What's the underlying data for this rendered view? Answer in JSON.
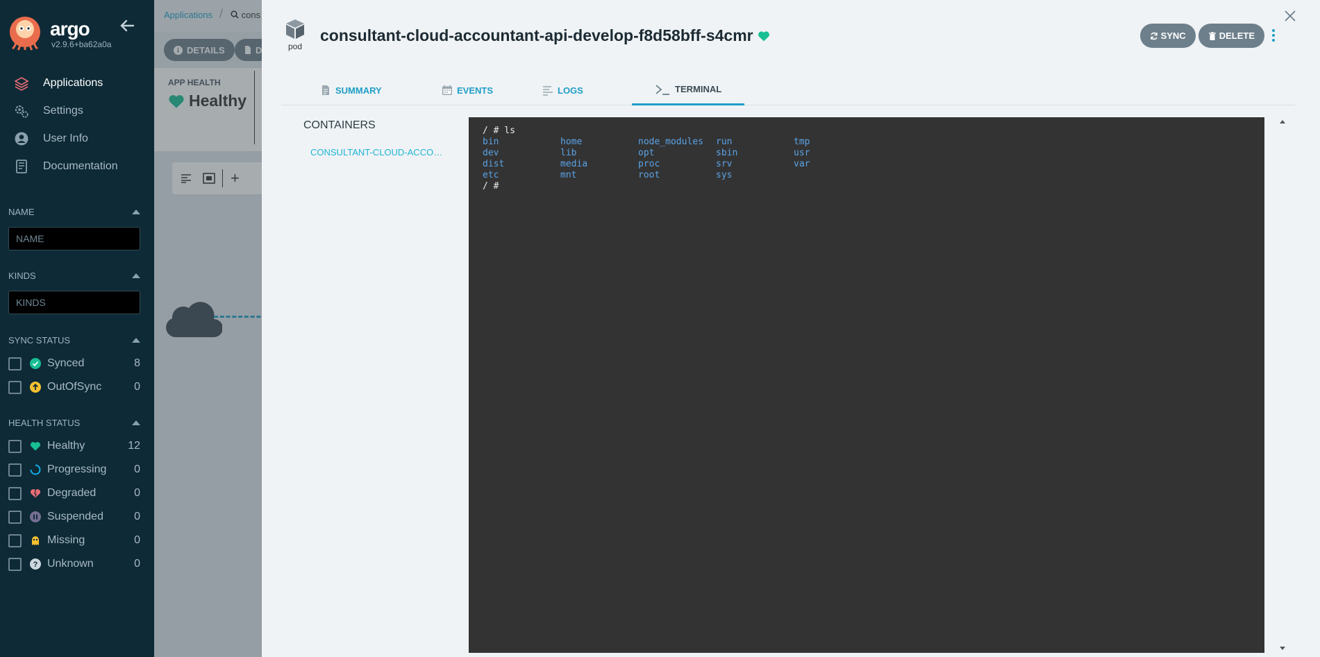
{
  "sidebar": {
    "logo_text": "argo",
    "version": "v2.9.6+ba62a0a",
    "nav": [
      {
        "label": "Applications",
        "icon": "layers-icon",
        "active": true
      },
      {
        "label": "Settings",
        "icon": "gears-icon",
        "active": false
      },
      {
        "label": "User Info",
        "icon": "user-circle-icon",
        "active": false
      },
      {
        "label": "Documentation",
        "icon": "book-icon",
        "active": false
      }
    ],
    "name_filter": {
      "title": "NAME",
      "placeholder": "NAME"
    },
    "kinds_filter": {
      "title": "KINDS",
      "placeholder": "KINDS"
    },
    "sync_status": {
      "title": "SYNC STATUS",
      "items": [
        {
          "label": "Synced",
          "count": "8",
          "color": "#18be94"
        },
        {
          "label": "OutOfSync",
          "count": "0",
          "color": "#f4c030"
        }
      ]
    },
    "health_status": {
      "title": "HEALTH STATUS",
      "items": [
        {
          "label": "Healthy",
          "count": "12",
          "color": "#18be94"
        },
        {
          "label": "Progressing",
          "count": "0",
          "color": "#0dadea"
        },
        {
          "label": "Degraded",
          "count": "0",
          "color": "#e96d76"
        },
        {
          "label": "Suspended",
          "count": "0",
          "color": "#766f94"
        },
        {
          "label": "Missing",
          "count": "0",
          "color": "#f4c030"
        },
        {
          "label": "Unknown",
          "count": "0",
          "color": "#ccd6dd"
        }
      ]
    }
  },
  "background": {
    "breadcrumb": "Applications",
    "search_partial": "cons",
    "details_btn": "DETAILS",
    "diff_btn_partial": "D",
    "app_health_label": "APP HEALTH",
    "app_health_value": "Healthy"
  },
  "panel": {
    "kind_label": "pod",
    "title": "consultant-cloud-accountant-api-develop-f8d58bff-s4cmr",
    "sync_label": "SYNC",
    "delete_label": "DELETE",
    "tabs": [
      {
        "label": "SUMMARY",
        "icon": "file-icon"
      },
      {
        "label": "EVENTS",
        "icon": "calendar-icon"
      },
      {
        "label": "LOGS",
        "icon": "lines-icon"
      },
      {
        "label": "TERMINAL",
        "icon": "terminal-icon"
      }
    ],
    "containers_title": "CONTAINERS",
    "container_name": "CONSULTANT-CLOUD-ACCOUNTANT-API",
    "terminal": {
      "prompt_cmd": "/ # ls",
      "files": [
        "bin",
        "home",
        "node_modules",
        "run",
        "tmp",
        "dev",
        "lib",
        "opt",
        "sbin",
        "usr",
        "dist",
        "media",
        "proc",
        "srv",
        "var",
        "etc",
        "mnt",
        "root",
        "sys",
        ""
      ],
      "prompt_end": "/ #"
    }
  },
  "colors": {
    "accent": "#1f9ec7",
    "sidebar_bg": "#0d2a36",
    "healthy": "#18be94",
    "terminal_bg": "#333333",
    "terminal_dir": "#5ba3e6"
  }
}
